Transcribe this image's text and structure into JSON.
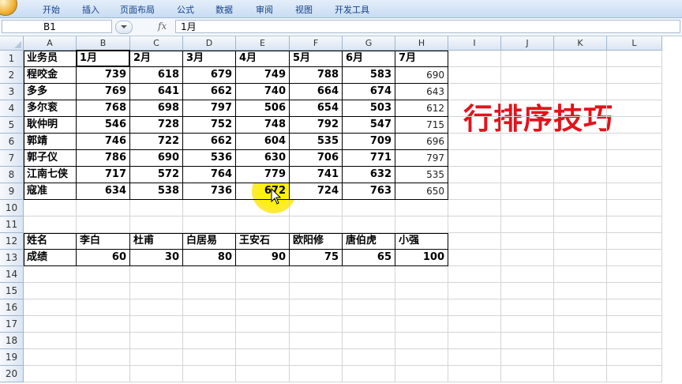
{
  "ribbon": {
    "tabs": [
      "开始",
      "插入",
      "页面布局",
      "公式",
      "数据",
      "审阅",
      "视图",
      "开发工具"
    ]
  },
  "formula_bar": {
    "name_box": "B1",
    "fx_icon": "fx-icon",
    "value": "1月"
  },
  "columns": [
    "A",
    "B",
    "C",
    "D",
    "E",
    "F",
    "G",
    "H",
    "I",
    "J",
    "K",
    "L"
  ],
  "rows": [
    "1",
    "2",
    "3",
    "4",
    "5",
    "6",
    "7",
    "8",
    "9",
    "10",
    "11",
    "12",
    "13",
    "14",
    "15",
    "16",
    "17",
    "18",
    "19",
    "20"
  ],
  "table1": {
    "header": [
      "业务员",
      "1月",
      "2月",
      "3月",
      "4月",
      "5月",
      "6月",
      "7月"
    ],
    "rows": [
      [
        "程咬金",
        "739",
        "618",
        "679",
        "749",
        "788",
        "583",
        "690"
      ],
      [
        "多多",
        "769",
        "641",
        "662",
        "740",
        "664",
        "674",
        "643"
      ],
      [
        "多尔衮",
        "768",
        "698",
        "797",
        "506",
        "654",
        "503",
        "612"
      ],
      [
        "耿仲明",
        "546",
        "728",
        "752",
        "748",
        "792",
        "547",
        "715"
      ],
      [
        "郭靖",
        "746",
        "722",
        "662",
        "604",
        "535",
        "709",
        "696"
      ],
      [
        "郭子仪",
        "786",
        "690",
        "536",
        "630",
        "706",
        "771",
        "797"
      ],
      [
        "江南七侠",
        "717",
        "572",
        "764",
        "779",
        "741",
        "632",
        "535"
      ],
      [
        "寇准",
        "634",
        "538",
        "736",
        "672",
        "724",
        "763",
        "650"
      ]
    ]
  },
  "table2": {
    "header": [
      "姓名",
      "李白",
      "杜甫",
      "白居易",
      "王安石",
      "欧阳修",
      "唐伯虎",
      "小强"
    ],
    "row": [
      "成绩",
      "60",
      "30",
      "80",
      "90",
      "75",
      "65",
      "100"
    ]
  },
  "overlay_text": "行排序技巧",
  "colors": {
    "overlay": "#e4121a",
    "highlight": "#fff000",
    "ribbon_text": "#15428b"
  }
}
